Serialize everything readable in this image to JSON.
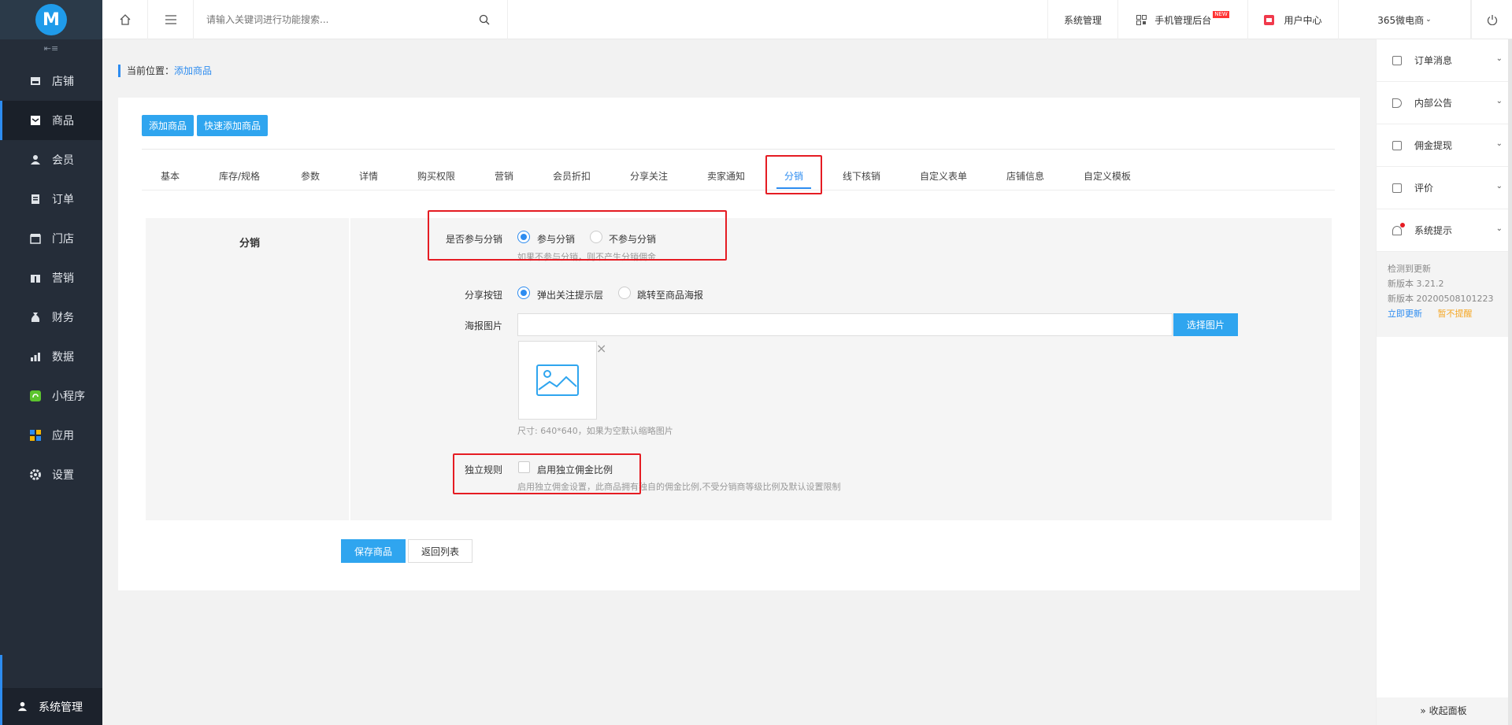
{
  "brand": {
    "logo_text": "M"
  },
  "sidebar": {
    "collapse_icon": "collapse-menu-icon",
    "items": [
      {
        "label": "店铺",
        "icon": "store-icon"
      },
      {
        "label": "商品",
        "icon": "goods-icon",
        "active": true
      },
      {
        "label": "会员",
        "icon": "member-icon"
      },
      {
        "label": "订单",
        "icon": "order-icon"
      },
      {
        "label": "门店",
        "icon": "shop-icon"
      },
      {
        "label": "营销",
        "icon": "gift-icon"
      },
      {
        "label": "财务",
        "icon": "finance-icon"
      },
      {
        "label": "数据",
        "icon": "chart-icon"
      },
      {
        "label": "小程序",
        "icon": "miniapp-icon"
      },
      {
        "label": "应用",
        "icon": "apps-icon"
      },
      {
        "label": "设置",
        "icon": "gear-icon"
      }
    ],
    "system_admin": "系统管理"
  },
  "topbar": {
    "search_placeholder": "请输入关键词进行功能搜索...",
    "system_manage": "系统管理",
    "mobile_admin": "手机管理后台",
    "new_badge": "NEW",
    "user_center": "用户中心",
    "store_name": "365微电商"
  },
  "breadcrumb": {
    "prefix": "当前位置：",
    "current": "添加商品"
  },
  "actions": {
    "add_goods": "添加商品",
    "quick_add": "快速添加商品"
  },
  "tabs": [
    "基本",
    "库存/规格",
    "参数",
    "详情",
    "购买权限",
    "营销",
    "会员折扣",
    "分享关注",
    "卖家通知",
    "分销",
    "线下核销",
    "自定义表单",
    "店铺信息",
    "自定义模板"
  ],
  "active_tab": "分销",
  "form": {
    "section_title": "分销",
    "participate": {
      "label": "是否参与分销",
      "options": [
        "参与分销",
        "不参与分销"
      ],
      "selected": "参与分销",
      "hint": "如果不参与分销，则不产生分销佣金"
    },
    "share_button": {
      "label": "分享按钮",
      "options": [
        "弹出关注提示层",
        "跳转至商品海报"
      ],
      "selected": "弹出关注提示层"
    },
    "poster": {
      "label": "海报图片",
      "value": "",
      "choose_button": "选择图片",
      "remove_symbol": "×",
      "hint": "尺寸: 640*640，如果为空默认缩略图片"
    },
    "independent_rule": {
      "label": "独立规则",
      "checkbox_label": "启用独立佣金比例",
      "checked": false,
      "hint": "启用独立佣金设置，此商品拥有独自的佣金比例,不受分销商等级比例及默认设置限制"
    }
  },
  "footer_buttons": {
    "save": "保存商品",
    "back": "返回列表"
  },
  "right_panel": {
    "items": [
      {
        "label": "订单消息",
        "icon": "order-message-icon"
      },
      {
        "label": "内部公告",
        "icon": "announcement-icon"
      },
      {
        "label": "佣金提现",
        "icon": "withdraw-icon"
      },
      {
        "label": "评价",
        "icon": "comment-icon"
      },
      {
        "label": "系统提示",
        "icon": "bell-icon"
      }
    ],
    "update": {
      "title": "检测到更新",
      "version": "新版本 3.21.2",
      "build": "新版本 20200508101223",
      "update_now": "立即更新",
      "remind_later": "暂不提醒"
    },
    "collapse": "» 收起面板"
  },
  "colors": {
    "accent": "#2fa5ef",
    "sidebar_bg": "#252d39",
    "highlight_box": "#e51c23"
  }
}
